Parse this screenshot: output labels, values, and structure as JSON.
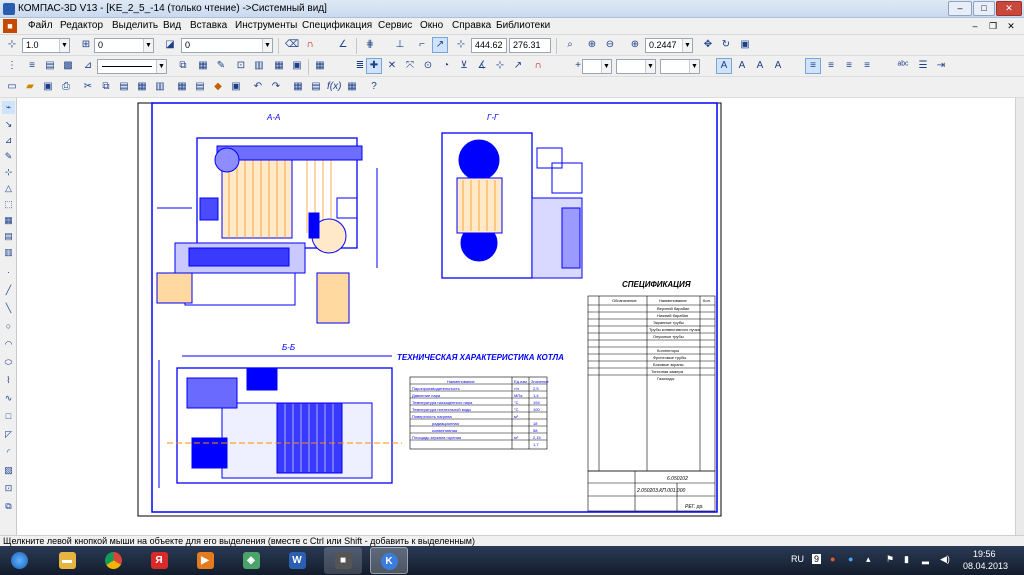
{
  "window": {
    "title": "КОМПАС-3D V13 - [KE_2_5_-14 (только чтение) ->Системный вид]",
    "minimize": "–",
    "maximize": "□",
    "close": "✕"
  },
  "menu": [
    "Файл",
    "Редактор",
    "Выделить",
    "Вид",
    "Вставка",
    "Инструменты",
    "Спецификация",
    "Сервис",
    "Окно",
    "Справка",
    "Библиотеки"
  ],
  "toolbar1": {
    "step": "1.0",
    "layer": "0",
    "style": "0",
    "coord_x": "444.62",
    "coord_y": "276.31",
    "zoom": "0.2447"
  },
  "drawing": {
    "section_aa": "А-А",
    "section_gg": "Г-Г",
    "section_bb": "Б-Б",
    "tech_title": "ТЕХНИЧЕСКАЯ ХАРАКТЕРИСТИКА КОТЛА",
    "spec_title": "СПЕЦИФИКАЦИЯ",
    "tech_headers": [
      "Наименование",
      "Ед.изм",
      "Значение"
    ],
    "tech_rows": [
      [
        "Паропроизводительность",
        "т/ч",
        "2,5"
      ],
      [
        "Давление пара",
        "МПа",
        "1,4"
      ],
      [
        "Температура насыщенного пара",
        "°С",
        "194"
      ],
      [
        "Температура питательной воды",
        "°С",
        "100"
      ],
      [
        "Поверхность нагрева",
        "м²",
        ""
      ],
      [
        "радиационная",
        "",
        "18"
      ],
      [
        "конвективная",
        "",
        "58"
      ],
      [
        "Площадь зеркала горения",
        "м²",
        "2,15"
      ],
      [
        "",
        "",
        "1,7"
      ]
    ],
    "spec_headers": [
      "Обозначение",
      "Наименование",
      "Кол."
    ],
    "spec_rows": [
      "Верхний барабан",
      "Нижний барабан",
      "Экранные трубы",
      "Трубы конвективного пучка",
      "Опускные трубы",
      "",
      "Коллекторы",
      "Фронтовые трубы",
      "Боковые экраны",
      "Топочная камера",
      "Газоходы"
    ],
    "stamp_code": "6.050102",
    "stamp_code2": "2.050203.КП.001.000",
    "stamp_scale": "РЕГ. рр."
  },
  "statusbar": {
    "text": "Щелкните левой кнопкой мыши на объекте для его выделения (вместе с Ctrl или Shift - добавить к выделенным)"
  },
  "taskbar": {
    "lang": "RU",
    "time": "19:56",
    "date": "08.04.2013"
  },
  "colors": {
    "drawing_blue": "#0000ff",
    "hatch_orange": "#ff8c00",
    "accent": "#1c3f8a"
  }
}
